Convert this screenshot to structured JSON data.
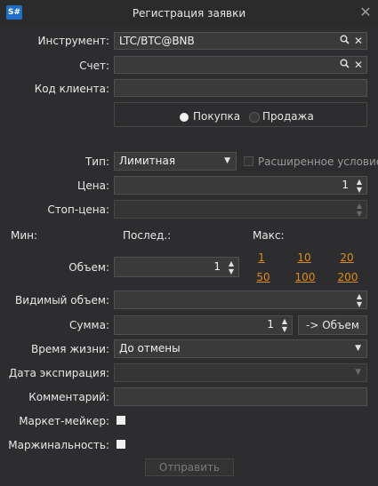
{
  "window": {
    "app_icon": "S#",
    "title": "Регистрация заявки",
    "close": "✕"
  },
  "labels": {
    "instrument": "Инструмент:",
    "account": "Счет:",
    "client_code": "Код клиента:",
    "type": "Тип:",
    "price": "Цена:",
    "stop_price": "Стоп-цена:",
    "min": "Мин:",
    "last": "Послед.:",
    "max": "Макс:",
    "volume": "Объем:",
    "visible_volume": "Видимый объем:",
    "sum": "Сумма:",
    "lifetime": "Время жизни:",
    "expiry_date": "Дата экспирация:",
    "comment": "Комментарий:",
    "market_maker": "Маркет-мейкер:",
    "margin": "Маржинальность:"
  },
  "fields": {
    "instrument_value": "LTC/BTC@BNB",
    "account_value": "",
    "client_code_value": "",
    "type_value": "Лимитная",
    "price_value": "1",
    "stop_price_value": "",
    "volume_value": "1",
    "visible_volume_value": "",
    "sum_value": "1",
    "lifetime_value": "До отмены",
    "expiry_value": "",
    "comment_value": ""
  },
  "side": {
    "buy": "Покупка",
    "sell": "Продажа",
    "selected": "buy"
  },
  "extended_condition": "Расширенное условие",
  "volume_presets": [
    "1",
    "10",
    "20",
    "50",
    "100",
    "200"
  ],
  "buttons": {
    "to_volume": "-> Объем",
    "submit": "Отправить"
  },
  "checkboxes": {
    "market_maker": false,
    "margin": false
  },
  "colors": {
    "link": "#e08a1e",
    "accent": "#1e6fc8"
  }
}
